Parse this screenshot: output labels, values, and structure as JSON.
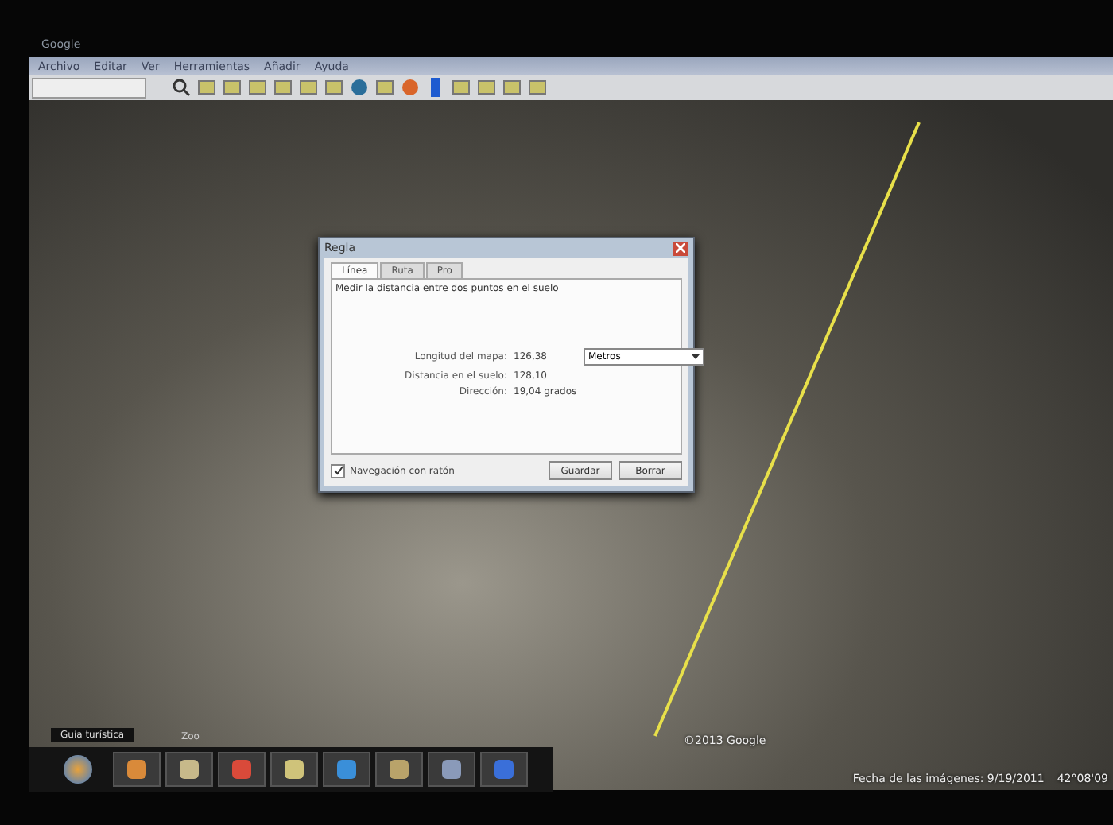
{
  "window": {
    "title": "Google"
  },
  "menu": [
    "Archivo",
    "Editar",
    "Ver",
    "Herramientas",
    "Añadir",
    "Ayuda"
  ],
  "dialog": {
    "title": "Regla",
    "tabs": [
      {
        "label": "Línea",
        "selected": true
      },
      {
        "label": "Ruta",
        "selected": false
      },
      {
        "label": "Pro",
        "selected": false
      }
    ],
    "description": "Medir la distancia entre dos puntos en el suelo",
    "measurements": [
      {
        "label": "Longitud del mapa:",
        "value": "126,38",
        "unit": "Metros"
      },
      {
        "label": "Distancia en el suelo:",
        "value": "128,10"
      },
      {
        "label": "Dirección:",
        "value": "19,04 grados"
      }
    ],
    "mouse_navigation": {
      "label": "Navegación con ratón",
      "checked": true
    },
    "buttons": [
      "Guardar",
      "Borrar"
    ]
  },
  "map": {
    "copyright": "©2013 Google",
    "imagery_date": "Fecha de las imágenes: 9/19/2011",
    "coordinates": "42°08'09"
  },
  "taskbar": {
    "tooltip": "Guía turística",
    "tooltip_2": "Zoo"
  }
}
